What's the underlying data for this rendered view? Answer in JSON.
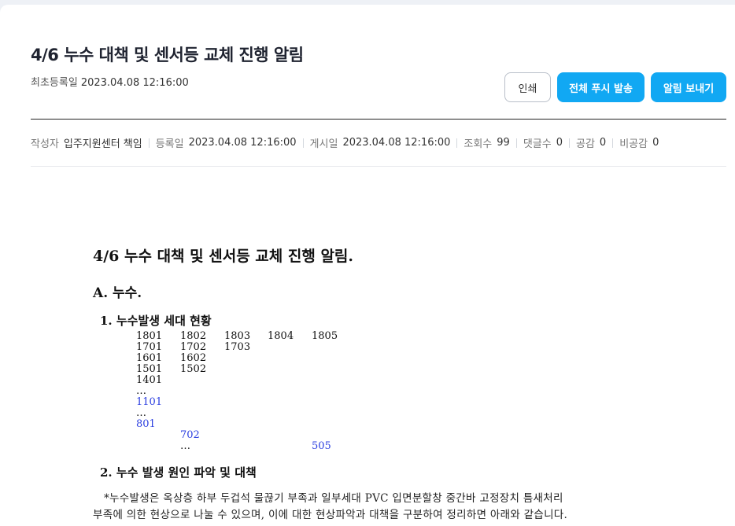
{
  "header": {
    "title": "4/6 누수 대책 및 센서등 교체 진행 알림",
    "first_registered_label": "최초등록일",
    "first_registered_value": "2023.04.08 12:16:00"
  },
  "buttons": {
    "print": "인쇄",
    "push_all": "전체 푸시 발송",
    "send_alarm": "알림 보내기"
  },
  "meta": {
    "author_label": "작성자",
    "author_value": "입주지원센터 책임",
    "registered_label": "등록일",
    "registered_value": "2023.04.08 12:16:00",
    "posted_label": "게시일",
    "posted_value": "2023.04.08 12:16:00",
    "views_label": "조회수",
    "views_value": "99",
    "comments_label": "댓글수",
    "comments_value": "0",
    "likes_label": "공감",
    "likes_value": "0",
    "dislikes_label": "비공감",
    "dislikes_value": "0"
  },
  "document": {
    "title": "4/6 누수 대책 및 센서등 교체 진행 알림.",
    "section_a": "A. 누수.",
    "sub1": "1. 누수발생 세대 현황",
    "units": {
      "r1": [
        "1801",
        "1802",
        "1803",
        "1804",
        "1805"
      ],
      "r2": [
        "1701",
        "1702",
        "1703"
      ],
      "r3": [
        "1601",
        "1602"
      ],
      "r4": [
        "1501",
        "1502"
      ],
      "r5": [
        "1401"
      ],
      "r6": [
        "…"
      ],
      "r7": [
        "1101"
      ],
      "r8": [
        "…"
      ],
      "r9": [
        "801"
      ],
      "r10": [
        "702"
      ],
      "r11": [
        "…",
        "505"
      ]
    },
    "sub2": "2. 누수 발생 원인 파악 및 대책",
    "para_line1": "*누수발생은 옥상층 하부 두겁석 물끊기 부족과 일부세대 PVC 입면분할창 중간바 고정장치 틈새처리",
    "para_line2": "부족에 의한 현상으로 나눌 수 있으며, 이에 대한 현상파악과 대책을 구분하여 정리하면 아래와 같습니다."
  }
}
